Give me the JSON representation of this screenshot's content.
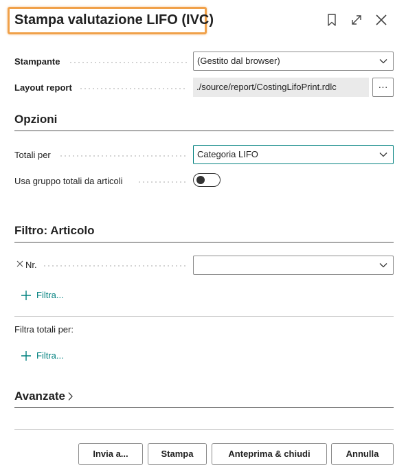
{
  "header": {
    "title": "Stampa valutazione LIFO (IVC)",
    "icons": [
      "bookmark-icon",
      "expand-icon",
      "close-icon"
    ]
  },
  "printer": {
    "label": "Stampante",
    "value": "(Gestito dal browser)"
  },
  "layout": {
    "label": "Layout report",
    "value": "./source/report/CostingLifoPrint.rdlc",
    "ellipsis": "···"
  },
  "options": {
    "title": "Opzioni",
    "totals_by_label": "Totali per",
    "totals_by_value": "Categoria LIFO",
    "use_group_label": "Usa gruppo totali da articoli",
    "use_group_on": false
  },
  "item_filter": {
    "title": "Filtro: Articolo",
    "no_label": "Nr.",
    "no_value": "",
    "add_filter": "Filtra..."
  },
  "totals_filter": {
    "label": "Filtra totali per:",
    "add_filter": "Filtra..."
  },
  "advanced": {
    "title": "Avanzate"
  },
  "footer": {
    "send_to": "Invia a...",
    "print": "Stampa",
    "preview_close": "Anteprima & chiudi",
    "cancel": "Annulla"
  },
  "colors": {
    "accent": "#00807f",
    "title_highlight": "#f0a14a"
  }
}
